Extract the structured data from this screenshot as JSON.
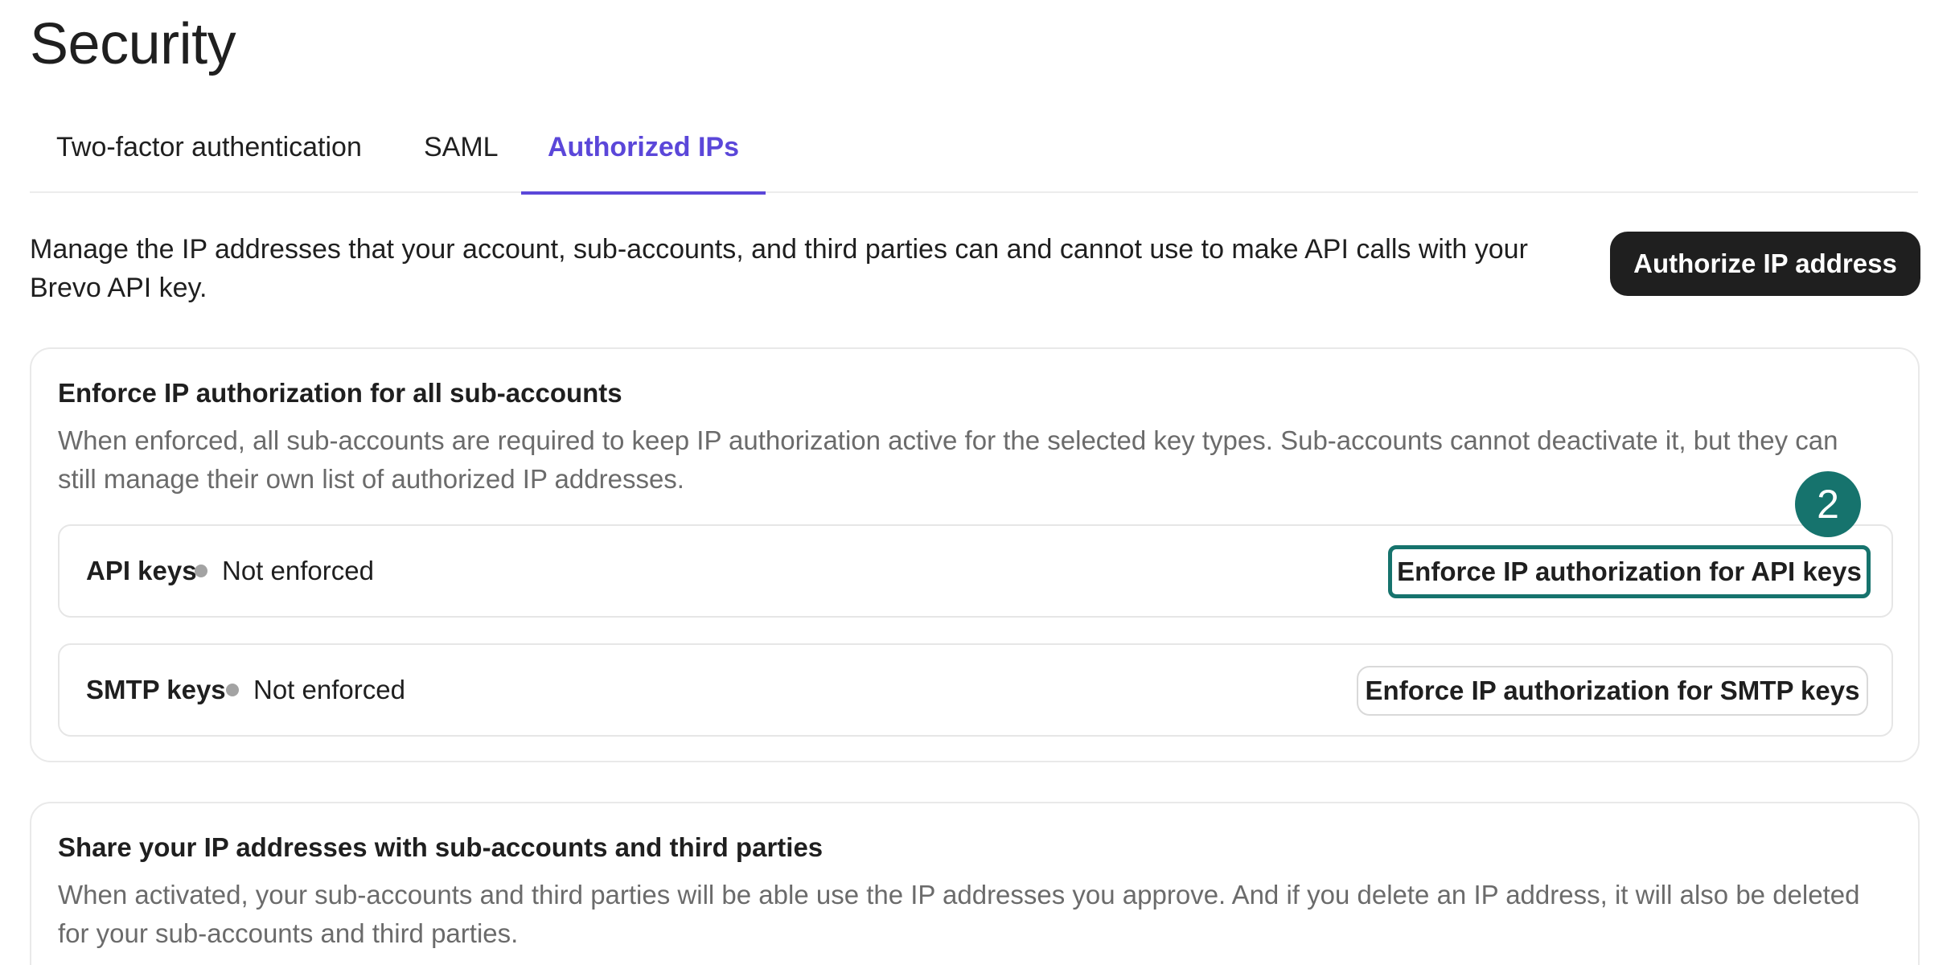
{
  "page": {
    "title": "Security"
  },
  "tabs": [
    {
      "label": "Two-factor authentication"
    },
    {
      "label": "SAML"
    },
    {
      "label": "Authorized IPs",
      "active": true
    }
  ],
  "intro": {
    "text": "Manage the IP addresses that your account, sub-accounts, and third parties can and cannot use to make API calls with your Brevo API key."
  },
  "header_button": {
    "label": "Authorize IP address"
  },
  "enforce_card": {
    "title": "Enforce IP authorization for all sub-accounts",
    "description": "When enforced, all sub-accounts are required to keep IP authorization active for the selected key types. Sub-accounts cannot deactivate it, but they can still manage their own list of authorized IP addresses.",
    "rows": [
      {
        "label": "API keys",
        "status": "Not enforced",
        "button": "Enforce IP authorization for API keys"
      },
      {
        "label": "SMTP keys",
        "status": "Not enforced",
        "button": "Enforce IP authorization for SMTP keys"
      }
    ]
  },
  "share_card": {
    "title": "Share your IP addresses with sub-accounts and third parties",
    "description": "When activated, your sub-accounts and third parties will be able use the IP addresses you approve. And if you delete an IP address, it will also be deleted for your sub-accounts and third parties."
  },
  "step_badge": {
    "number": "2"
  },
  "colors": {
    "accent": "#5b47d9",
    "highlight": "#16736d",
    "primary_button": "#1f1f1f",
    "status_dot": "#a3a3a3"
  }
}
